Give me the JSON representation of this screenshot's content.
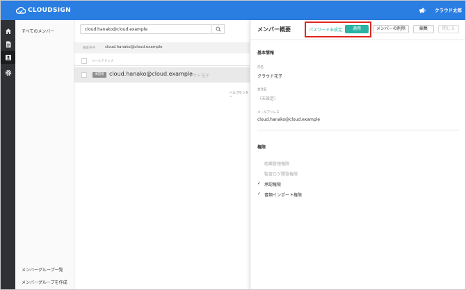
{
  "app": {
    "logo_text": "CLOUDSIGN",
    "user_name": "クラウド太郎"
  },
  "colors": {
    "brand": "#2a7de1",
    "accent": "#2ab3a5",
    "highlight": "#e0261b"
  },
  "rail": {
    "items": [
      {
        "icon": "home-icon"
      },
      {
        "icon": "document-icon"
      },
      {
        "icon": "contacts-icon",
        "active": true
      },
      {
        "icon": "gear-icon"
      }
    ]
  },
  "sidebar": {
    "all_members": "すべてのメンバー",
    "group_list": "メンバーグループ一覧",
    "create_group": "メンバーグループを作成"
  },
  "list": {
    "search_value": "cloud.hanako@cloud.example",
    "filter_label": "検索条件",
    "filter_value": "cloud.hanako@cloud.example",
    "column_email": "メールアドレス",
    "rows": [
      {
        "badge": "承認者",
        "email": "cloud.hanako@cloud.example",
        "name": "クラウド花子"
      }
    ],
    "help_text": "ヘルプセンター"
  },
  "detail": {
    "title": "メンバー概要",
    "password_unset": "パスワード未設定",
    "apply": "適用",
    "delete": "メンバーの削除",
    "edit": "編集",
    "close": "閉じる",
    "basic_info": "基本情報",
    "name_label": "氏名",
    "name_value": "クラウド花子",
    "company_label": "会社名",
    "company_value": "（未設定）",
    "email_label": "メールアドレス",
    "email_value": "cloud.hanako@cloud.example",
    "permissions_heading": "権限",
    "permissions": [
      {
        "label": "組織管理権限",
        "checked": false
      },
      {
        "label": "監査ログ閲覧権限",
        "checked": false
      },
      {
        "label": "承認権限",
        "checked": true
      },
      {
        "label": "書類インポート権限",
        "checked": true
      }
    ]
  }
}
